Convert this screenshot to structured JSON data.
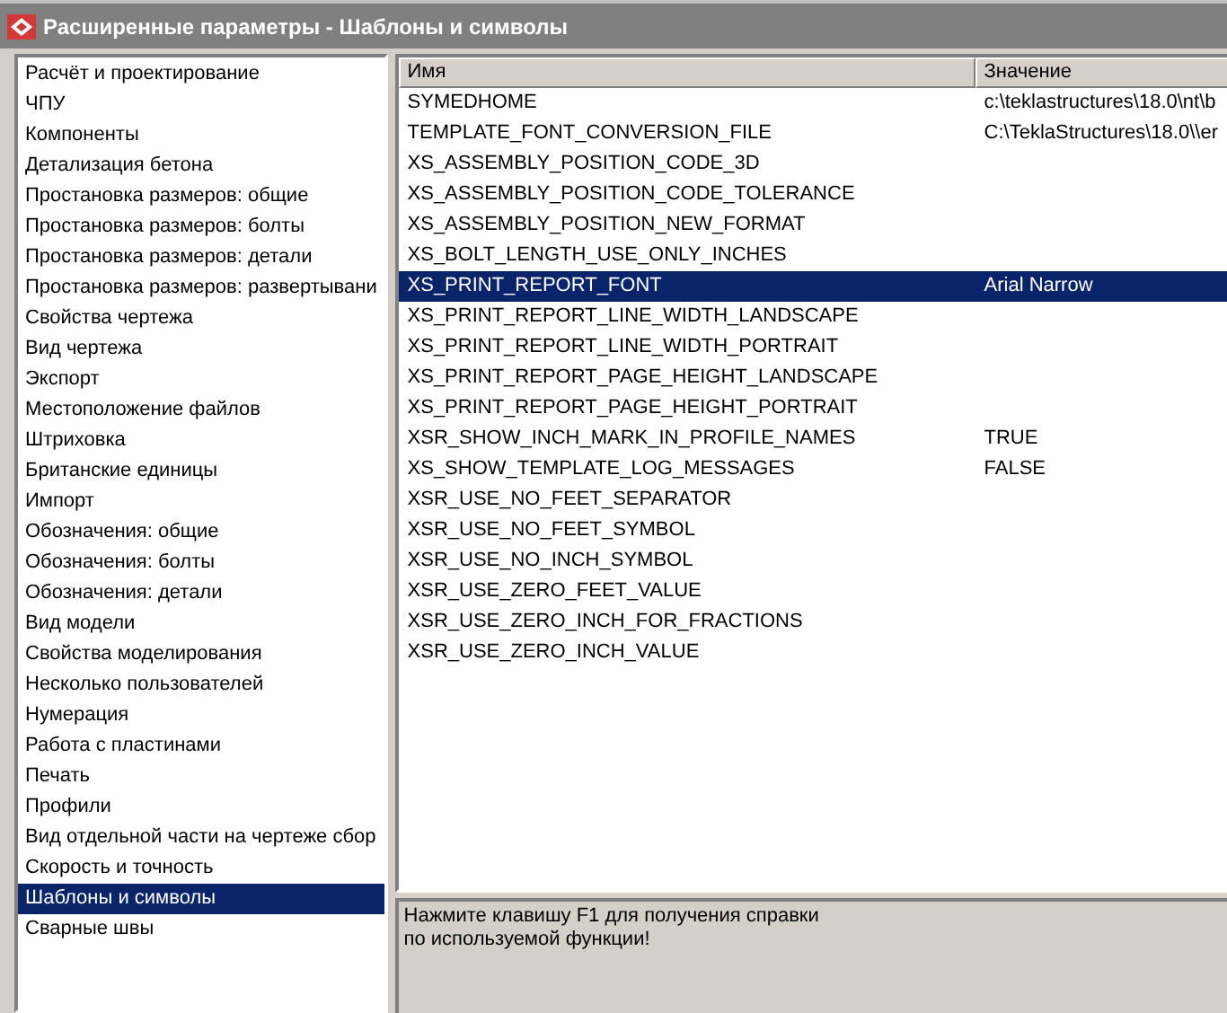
{
  "window": {
    "title": "Расширенные параметры - Шаблоны и символы"
  },
  "categories": [
    {
      "label": "Расчёт и проектирование",
      "selected": false
    },
    {
      "label": "ЧПУ",
      "selected": false
    },
    {
      "label": "Компоненты",
      "selected": false
    },
    {
      "label": "Детализация бетона",
      "selected": false
    },
    {
      "label": "Простановка размеров: общие",
      "selected": false
    },
    {
      "label": "Простановка размеров: болты",
      "selected": false
    },
    {
      "label": "Простановка размеров: детали",
      "selected": false
    },
    {
      "label": "Простановка размеров: развертывани",
      "selected": false
    },
    {
      "label": "Свойства чертежа",
      "selected": false
    },
    {
      "label": "Вид чертежа",
      "selected": false
    },
    {
      "label": "Экспорт",
      "selected": false
    },
    {
      "label": "Местоположение файлов",
      "selected": false
    },
    {
      "label": "Штриховка",
      "selected": false
    },
    {
      "label": "Британские единицы",
      "selected": false
    },
    {
      "label": "Импорт",
      "selected": false
    },
    {
      "label": "Обозначения: общие",
      "selected": false
    },
    {
      "label": "Обозначения: болты",
      "selected": false
    },
    {
      "label": "Обозначения: детали",
      "selected": false
    },
    {
      "label": "Вид модели",
      "selected": false
    },
    {
      "label": "Свойства моделирования",
      "selected": false
    },
    {
      "label": "Несколько пользователей",
      "selected": false
    },
    {
      "label": "Нумерация",
      "selected": false
    },
    {
      "label": "Работа с пластинами",
      "selected": false
    },
    {
      "label": "Печать",
      "selected": false
    },
    {
      "label": "Профили",
      "selected": false
    },
    {
      "label": "Вид отдельной части на чертеже сбор",
      "selected": false
    },
    {
      "label": "Скорость и точность",
      "selected": false
    },
    {
      "label": "Шаблоны и символы",
      "selected": true
    },
    {
      "label": "Сварные швы",
      "selected": false
    }
  ],
  "table": {
    "columns": [
      "Имя",
      "Значение"
    ],
    "rows": [
      {
        "name": "SYMEDHOME",
        "value": "c:\\teklastructures\\18.0\\nt\\b",
        "selected": false
      },
      {
        "name": "TEMPLATE_FONT_CONVERSION_FILE",
        "value": "C:\\TeklaStructures\\18.0\\\\er",
        "selected": false
      },
      {
        "name": "XS_ASSEMBLY_POSITION_CODE_3D",
        "selected": false
      },
      {
        "name": "XS_ASSEMBLY_POSITION_CODE_TOLERANCE",
        "selected": false
      },
      {
        "name": "XS_ASSEMBLY_POSITION_NEW_FORMAT",
        "selected": false
      },
      {
        "name": "XS_BOLT_LENGTH_USE_ONLY_INCHES",
        "selected": false
      },
      {
        "name": "XS_PRINT_REPORT_FONT",
        "value": "Arial Narrow",
        "selected": true
      },
      {
        "name": "XS_PRINT_REPORT_LINE_WIDTH_LANDSCAPE",
        "selected": false
      },
      {
        "name": "XS_PRINT_REPORT_LINE_WIDTH_PORTRAIT",
        "selected": false
      },
      {
        "name": "XS_PRINT_REPORT_PAGE_HEIGHT_LANDSCAPE",
        "selected": false
      },
      {
        "name": "XS_PRINT_REPORT_PAGE_HEIGHT_PORTRAIT",
        "selected": false
      },
      {
        "name": "XSR_SHOW_INCH_MARK_IN_PROFILE_NAMES",
        "value": "TRUE",
        "selected": false
      },
      {
        "name": "XS_SHOW_TEMPLATE_LOG_MESSAGES",
        "value": "FALSE",
        "selected": false
      },
      {
        "name": "XSR_USE_NO_FEET_SEPARATOR",
        "selected": false
      },
      {
        "name": "XSR_USE_NO_FEET_SYMBOL",
        "selected": false
      },
      {
        "name": "XSR_USE_NO_INCH_SYMBOL",
        "selected": false
      },
      {
        "name": "XSR_USE_ZERO_FEET_VALUE",
        "selected": false
      },
      {
        "name": "XSR_USE_ZERO_INCH_FOR_FRACTIONS",
        "selected": false
      },
      {
        "name": "XSR_USE_ZERO_INCH_VALUE",
        "selected": false
      }
    ]
  },
  "help": {
    "text": "Нажмите клавишу F1 для получения справки\nпо используемой функции!"
  }
}
